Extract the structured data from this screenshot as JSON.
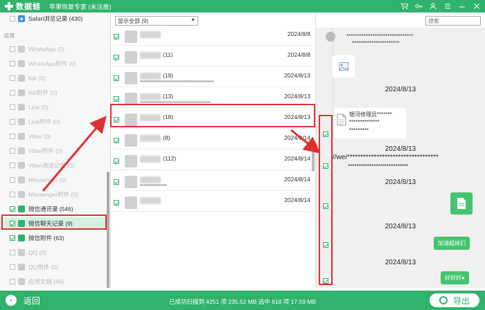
{
  "titlebar": {
    "logo_text": "数据蛙",
    "title": "苹果恢复专家 (未注册)"
  },
  "sidebar": {
    "top_item": "Safari浏览记录 (430)",
    "section_label": "应用",
    "items": [
      {
        "label": "WhatsApp (0)",
        "icon_color": "#25d366",
        "checked": false
      },
      {
        "label": "WhatsApp附件 (0)",
        "icon_color": "#25d366",
        "checked": false
      },
      {
        "label": "Kik (0)",
        "icon_color": "#7dd04e",
        "checked": false
      },
      {
        "label": "Kik附件 (0)",
        "icon_color": "#7dd04e",
        "checked": false
      },
      {
        "label": "Line (0)",
        "icon_color": "#2dbd5a",
        "checked": false
      },
      {
        "label": "Line附件 (0)",
        "icon_color": "#2dbd5a",
        "checked": false
      },
      {
        "label": "Viber (0)",
        "icon_color": "#7b519d",
        "checked": false
      },
      {
        "label": "Viber附件 (0)",
        "icon_color": "#7b519d",
        "checked": false
      },
      {
        "label": "Viber通话记录 (0)",
        "icon_color": "#7b519d",
        "checked": false
      },
      {
        "label": "Messenger (0)",
        "icon_color": "#0a84ff",
        "checked": false
      },
      {
        "label": "Messenger附件 (0)",
        "icon_color": "#0a84ff",
        "checked": false
      },
      {
        "label": "微信通讯录 (546)",
        "icon_color": "#2fb26b",
        "checked": true
      },
      {
        "label": "微信聊天记录 (9)",
        "icon_color": "#2fb26b",
        "checked": true
      },
      {
        "label": "微信附件 (63)",
        "icon_color": "#2fb26b",
        "checked": true
      },
      {
        "label": "QQ (0)",
        "icon_color": "#f2a33a",
        "checked": false
      },
      {
        "label": "QQ附件 (0)",
        "icon_color": "#f2a33a",
        "checked": false
      },
      {
        "label": "应用文档 (49)",
        "icon_color": "#888888",
        "checked": false
      }
    ]
  },
  "middle": {
    "filter_value": "显示全部 (9)",
    "rows": [
      {
        "name": "",
        "sub": "",
        "date": "2024/8/8"
      },
      {
        "name": "(11)",
        "sub": "",
        "date": "2024/8/8"
      },
      {
        "name": "(19)",
        "sub": "********************************************",
        "date": "2024/8/13"
      },
      {
        "name": "(13)",
        "sub": "******************************************",
        "date": "2024/8/13"
      },
      {
        "name": "(18)",
        "sub": "",
        "date": "2024/8/13"
      },
      {
        "name": "(8)",
        "sub": "",
        "date": "2024/8/14"
      },
      {
        "name": "(112)",
        "sub": "",
        "date": "2024/8/14"
      },
      {
        "name": "",
        "sub": "****************",
        "date": "2024/8/14"
      },
      {
        "name": "",
        "sub": "",
        "date": "2024/8/14"
      }
    ]
  },
  "right": {
    "search_placeholder": "搜索",
    "top_msg_line1": "*******************************",
    "top_msg_line2": "**********************",
    "date1": "2024/8/13",
    "file_line1": "银河修理员*******",
    "file_line2": "**************",
    "file_line3": "*********",
    "date2": "2024/8/13",
    "link_line1": "//wei**********************************",
    "link_line2": "****************************",
    "date3": "2024/8/13",
    "date4": "2024/8/13",
    "msg_green1": "加油姐妹们",
    "date5": "2024/8/13",
    "msg_green2": "好好好●"
  },
  "bottom": {
    "back_label": "返回",
    "status": "已成功扫描到 4251 项 235.52 MB  选中 618 项 17.59 MB",
    "export_label": "导出"
  },
  "colors": {
    "brand": "#2fb26b",
    "annotation": "#e03030"
  }
}
